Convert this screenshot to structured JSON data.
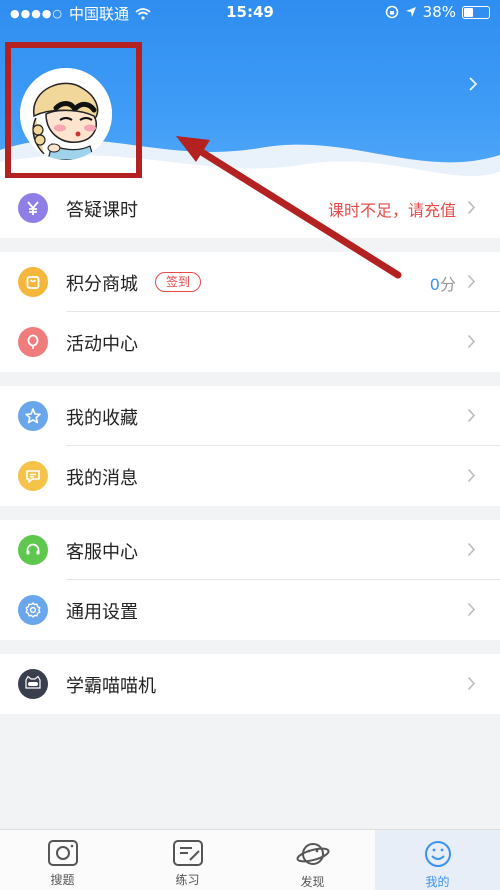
{
  "status_bar": {
    "carrier": "中国联通",
    "time": "15:49",
    "battery": "38%"
  },
  "menu": {
    "answer_hours": {
      "label": "答疑课时",
      "hint": "课时不足，请充值"
    },
    "points_mall": {
      "label": "积分商城",
      "badge": "签到",
      "points_value": "0",
      "points_unit": "分"
    },
    "activity_center": {
      "label": "活动中心"
    },
    "my_favorites": {
      "label": "我的收藏"
    },
    "my_messages": {
      "label": "我的消息"
    },
    "customer_service": {
      "label": "客服中心"
    },
    "general_settings": {
      "label": "通用设置"
    },
    "xueba_miaomiao": {
      "label": "学霸喵喵机"
    }
  },
  "tabbar": {
    "items": [
      {
        "label": "搜题",
        "icon": "camera-icon"
      },
      {
        "label": "练习",
        "icon": "edit-icon"
      },
      {
        "label": "发现",
        "icon": "planet-icon"
      },
      {
        "label": "我的",
        "icon": "smile-icon"
      }
    ],
    "active_index": 3
  },
  "colors": {
    "header_blue": "#2f8df0",
    "accent": "#3a93ee",
    "alert_red": "#e64a4a",
    "annotation_red": "#b32121"
  }
}
